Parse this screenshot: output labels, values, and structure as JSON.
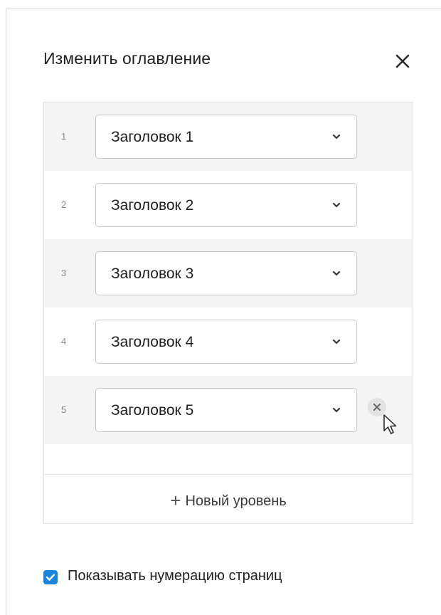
{
  "dialog": {
    "title": "Изменить оглавление",
    "close_icon": "close-icon"
  },
  "levels": [
    {
      "number": "1",
      "value": "Заголовок 1"
    },
    {
      "number": "2",
      "value": "Заголовок 2"
    },
    {
      "number": "3",
      "value": "Заголовок 3"
    },
    {
      "number": "4",
      "value": "Заголовок 4"
    },
    {
      "number": "5",
      "value": "Заголовок 5"
    }
  ],
  "add_level": {
    "plus": "+",
    "label": "Новый уровень"
  },
  "show_page_numbers": {
    "label": "Показывать нумерацию страниц",
    "checked": true
  },
  "colors": {
    "accent": "#1a83db",
    "row_shade": "#f4f4f4"
  }
}
